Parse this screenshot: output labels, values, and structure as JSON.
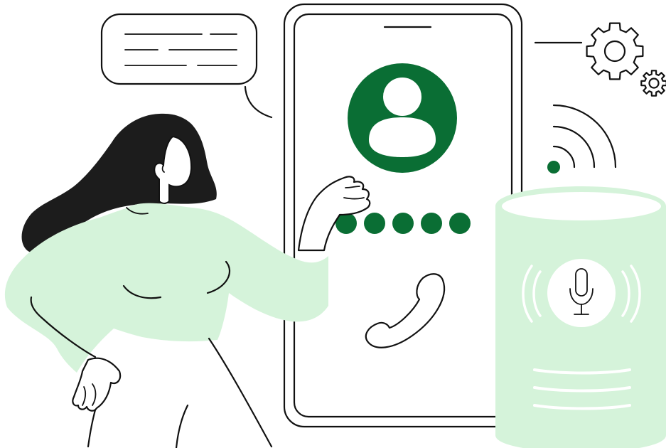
{
  "illustration": {
    "subject": "voice-assistant-call",
    "colors": {
      "accent": "#0a6e34",
      "mint": "#d5f3da",
      "ink": "#111111",
      "hair": "#1c1c1c",
      "background": "#ffffff"
    },
    "phone": {
      "icons": [
        "avatar-icon",
        "phone-handset-icon"
      ],
      "pin_dots": 5
    },
    "speaker": {
      "icons": [
        "microphone-icon"
      ]
    },
    "decorations": [
      "speech-bubble",
      "gear-icon",
      "wifi-signal-icon"
    ]
  }
}
